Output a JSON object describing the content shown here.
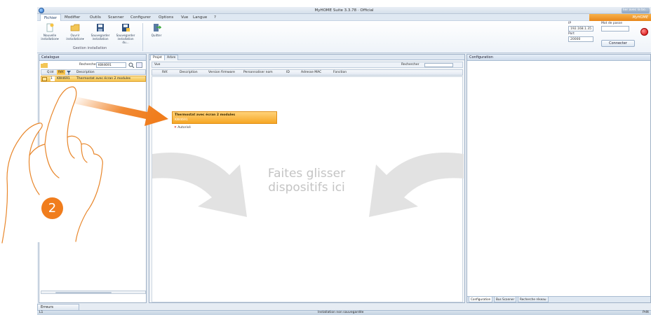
{
  "window": {
    "title": "MyHOME Suite 3.3.78 · Official",
    "controls_label": "lier avec la bo..."
  },
  "brand": "MyHOME",
  "menu": [
    {
      "label": "Fichier",
      "active": true
    },
    {
      "label": "Modifier",
      "active": false
    },
    {
      "label": "Outils",
      "active": false
    },
    {
      "label": "Scanner",
      "active": false
    },
    {
      "label": "Configurer",
      "active": false
    },
    {
      "label": "Options",
      "active": false
    },
    {
      "label": "Vue",
      "active": false
    },
    {
      "label": "Langue",
      "active": false
    },
    {
      "label": "?",
      "active": false
    }
  ],
  "ribbon": {
    "buttons": [
      {
        "label": "Nouvelle installation▾",
        "icon": "new-document-icon"
      },
      {
        "label": "Ouvrir installation▾",
        "icon": "open-folder-icon"
      },
      {
        "label": "Sauvegarder installation",
        "icon": "save-icon"
      },
      {
        "label": "Sauvegarder installation du...",
        "icon": "save-as-icon"
      },
      {
        "label": "Quitter",
        "icon": "exit-icon"
      }
    ],
    "group_label": "Gestion installation"
  },
  "connection": {
    "ip_label": "IP",
    "ip_value": "192.168.1.35",
    "port_label": "Port",
    "port_value": "20000",
    "password_label": "Mot de passe",
    "password_value": "",
    "connect_label": "Connecter",
    "status_color": "#d40000"
  },
  "catalogue": {
    "title": "Catalogue",
    "search_label": "Rechercher",
    "search_value": "KW4691",
    "columns": [
      "Q.té",
      "Réf.",
      "Description"
    ],
    "rows": [
      {
        "qty": "1",
        "ref": "KW4691",
        "description": "Thermostat avec écran 2 modules"
      }
    ]
  },
  "project": {
    "tabs": [
      {
        "label": "Projet",
        "active": true
      },
      {
        "label": "Arbre",
        "active": false
      }
    ],
    "view_label": "Vue",
    "search_label": "Rechercher",
    "columns": [
      "Réf.",
      "Description",
      "Version firmware",
      "Personnaliser nom",
      "ID",
      "Adresse MAC",
      "Fonction"
    ],
    "drop_hint_line1": "Faites glisser",
    "drop_hint_line2": "dispositifs ici",
    "dragged_item": {
      "title": "Thermostat avec écran 2 modules",
      "code": "KW4691",
      "auth_label": "Autorisé"
    }
  },
  "config": {
    "title": "Configuration",
    "bottom_tabs": [
      {
        "label": "Configuration",
        "active": true
      },
      {
        "label": "Bus Scanner",
        "active": false
      },
      {
        "label": "Recherche réseau",
        "active": false
      }
    ]
  },
  "bottom_tab": "Erreurs",
  "statusbar": {
    "left": "L1",
    "center": "Installation non sauvegardée",
    "right": "Prêt"
  },
  "tutorial": {
    "step": "2",
    "accent": "#f07d1d"
  }
}
